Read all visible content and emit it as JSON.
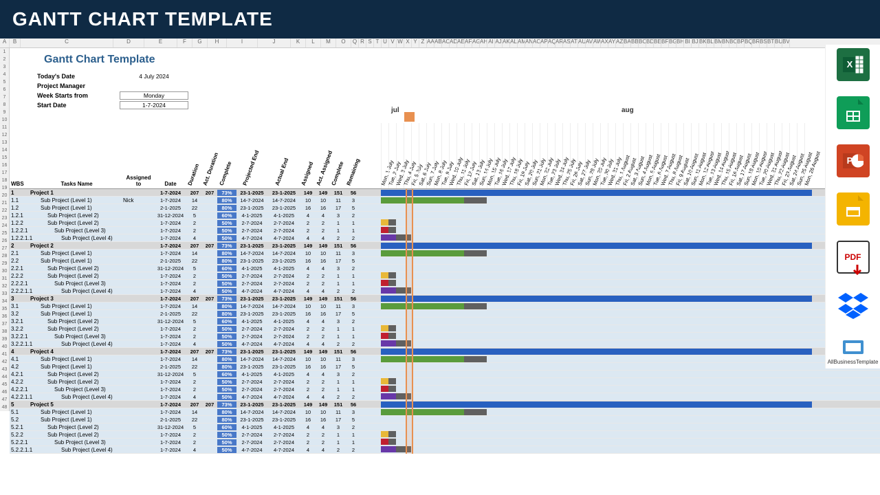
{
  "header": "GANTT CHART TEMPLATE",
  "title": "Gantt Chart Template",
  "meta": {
    "today_lbl": "Today's Date",
    "today_val": "4 July 2024",
    "pm_lbl": "Project Manager",
    "pm_val": "",
    "week_lbl": "Week Starts from",
    "week_val": "Monday",
    "start_lbl": "Start Date",
    "start_val": "1-7-2024"
  },
  "months": {
    "jul": "jul",
    "aug": "aug"
  },
  "cols": {
    "wbs": "WBS",
    "task": "Tasks Name",
    "assn": "Assigned to",
    "date": "Date",
    "dur": "Duration",
    "adur": "Act. Duration",
    "comp": "Complete",
    "pe": "Projected End",
    "ae": "Actual End",
    "asg": "Assigned",
    "aasg": "Act. Assigned",
    "cpl": "Complete",
    "rem": "Remaining"
  },
  "col_letters": [
    "A",
    "B",
    "C",
    "D",
    "E",
    "F",
    "G",
    "H",
    "I",
    "J",
    "K",
    "L",
    "M",
    "O",
    "Q",
    "R",
    "S",
    "T",
    "U",
    "V",
    "W",
    "X",
    "Y",
    "Z",
    "AA",
    "AB",
    "AC",
    "AD",
    "AE",
    "AF",
    "AG",
    "AH",
    "AI",
    "AJ",
    "AK",
    "AL",
    "AM",
    "AN",
    "AO",
    "AP",
    "AQ",
    "AR",
    "AS",
    "AT",
    "AU",
    "AV",
    "AW",
    "AX",
    "AY",
    "AZ",
    "BA",
    "BB",
    "BC",
    "BD",
    "BE",
    "BF",
    "BG",
    "BH",
    "BI",
    "BJ",
    "BK",
    "BL",
    "BM",
    "BN",
    "BO",
    "BP",
    "BQ",
    "BR",
    "BS",
    "BT",
    "BU",
    "BV"
  ],
  "dates": [
    "Mon, 1 July",
    "Tue, 2 July",
    "Wed, 3 July",
    "Thu, 4 July",
    "Fri, 5 July",
    "Sat, 6 July",
    "Sun, 7 July",
    "Mon, 8 July",
    "Tue, 9 July",
    "Wed, 10 July",
    "Thu, 11 July",
    "Fri, 12 July",
    "Sat, 13 July",
    "Sun, 14 July",
    "Mon, 15 July",
    "Tue, 16 July",
    "Wed, 17 July",
    "Thu, 18 July",
    "Fri, 19 July",
    "Sat, 20 July",
    "Sun, 21 July",
    "Mon, 22 July",
    "Tue, 23 July",
    "Wed, 24 July",
    "Thu, 25 July",
    "Fri, 26 July",
    "Sat, 27 July",
    "Sun, 28 July",
    "Mon, 29 July",
    "Tue, 30 July",
    "Wed, 31 July",
    "Thu, 1 August",
    "Fri, 2 August",
    "Sat, 3 August",
    "Sun, 4 August",
    "Mon, 5 August",
    "Tue, 6 August",
    "Wed, 7 August",
    "Thu, 8 August",
    "Fri, 9 August",
    "Sat, 10 August",
    "Sun, 11 August",
    "Mon, 12 August",
    "Tue, 13 August",
    "Wed, 14 August",
    "Thu, 15 August",
    "Fri, 16 August",
    "Sat, 17 August",
    "Sun, 18 August",
    "Mon, 19 August",
    "Tue, 20 August",
    "Wed, 21 August",
    "Thu, 22 August",
    "Fri, 23 August",
    "Sat, 24 August",
    "Sun, 25 August",
    "Mon, 26 August"
  ],
  "row_numbers": [
    1,
    2,
    3,
    4,
    5,
    6,
    7,
    8,
    9,
    10,
    11,
    12,
    13,
    14,
    15,
    16,
    17,
    18,
    19,
    20,
    21,
    22,
    23,
    24,
    25,
    26,
    27,
    28,
    29,
    30,
    31,
    32,
    33,
    34,
    35,
    36,
    37,
    38,
    39,
    40,
    41,
    42,
    43,
    44,
    45,
    46,
    47,
    48
  ],
  "projects": [
    {
      "wbs": "1",
      "name": "Project 1",
      "assn": "",
      "date": "1-7-2024",
      "dur": "207",
      "adur": "207",
      "comp": "73%",
      "pe": "23-1-2025",
      "ae": "23-1-2025",
      "asg": "149",
      "aasg": "149",
      "cpl": "151",
      "rem": "56",
      "type": "proj",
      "bar": {
        "start": 0,
        "len": 57,
        "color": "#2860c0"
      }
    },
    {
      "wbs": "1.1",
      "name": "Sub Project (Level 1)",
      "assn": "Nick",
      "date": "1-7-2024",
      "dur": "14",
      "adur": "",
      "comp": "80%",
      "pe": "14-7-2024",
      "ae": "14-7-2024",
      "asg": "10",
      "aasg": "10",
      "cpl": "11",
      "rem": "3",
      "type": "l1",
      "bar": {
        "start": 0,
        "len": 14,
        "color": "#5a9c3c",
        "grey": 11
      }
    },
    {
      "wbs": "1.2",
      "name": "Sub Project (Level 1)",
      "assn": "",
      "date": "2-1-2025",
      "dur": "22",
      "adur": "",
      "comp": "80%",
      "pe": "23-1-2025",
      "ae": "23-1-2025",
      "asg": "16",
      "aasg": "16",
      "cpl": "17",
      "rem": "5",
      "type": "l1",
      "bar": null
    },
    {
      "wbs": "1.2.1",
      "name": "Sub Project (Level 2)",
      "assn": "",
      "date": "31-12-2024",
      "dur": "5",
      "adur": "",
      "comp": "60%",
      "pe": "4-1-2025",
      "ae": "4-1-2025",
      "asg": "4",
      "aasg": "4",
      "cpl": "3",
      "rem": "2",
      "type": "l2",
      "bar": null
    },
    {
      "wbs": "1.2.2",
      "name": "Sub Project (Level 2)",
      "assn": "",
      "date": "1-7-2024",
      "dur": "2",
      "adur": "",
      "comp": "50%",
      "pe": "2-7-2024",
      "ae": "2-7-2024",
      "asg": "2",
      "aasg": "2",
      "cpl": "1",
      "rem": "1",
      "type": "l2",
      "segs": [
        {
          "c": "#e8b838"
        },
        {
          "c": "#606060"
        }
      ]
    },
    {
      "wbs": "1.2.2.1",
      "name": "Sub Project (Level 3)",
      "assn": "",
      "date": "1-7-2024",
      "dur": "2",
      "adur": "",
      "comp": "50%",
      "pe": "2-7-2024",
      "ae": "2-7-2024",
      "asg": "2",
      "aasg": "2",
      "cpl": "1",
      "rem": "1",
      "type": "l3",
      "segs": [
        {
          "c": "#c02030"
        },
        {
          "c": "#606060"
        }
      ]
    },
    {
      "wbs": "1.2.2.1.1",
      "name": "Sub Project (Level 4)",
      "assn": "",
      "date": "1-7-2024",
      "dur": "4",
      "adur": "",
      "comp": "50%",
      "pe": "4-7-2024",
      "ae": "4-7-2024",
      "asg": "4",
      "aasg": "4",
      "cpl": "2",
      "rem": "2",
      "type": "l4",
      "segs": [
        {
          "c": "#6838a8"
        },
        {
          "c": "#6838a8"
        },
        {
          "c": "#606060"
        },
        {
          "c": "#606060"
        }
      ]
    }
  ],
  "project_count": 5,
  "project_prefix": "Project ",
  "sub_prefix": "Sub Project (Level ",
  "sidebar": {
    "logo": "AllBusinessTemplate",
    "pdf": "PDF"
  }
}
